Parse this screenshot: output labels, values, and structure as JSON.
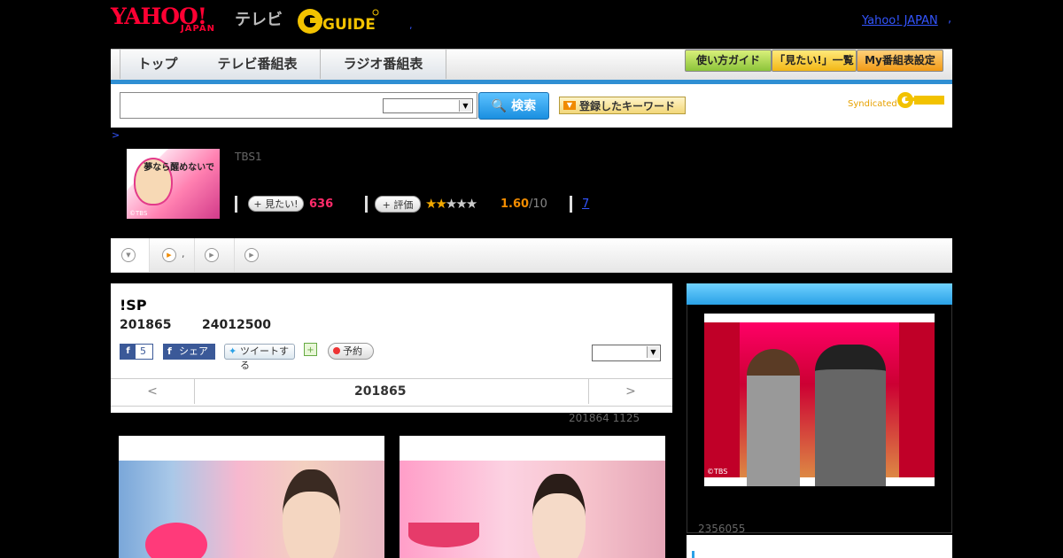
{
  "header": {
    "yahoo_logo": "YAHOO!",
    "japan_logo": "JAPAN",
    "tv_logo": "テレビ",
    "gguide_logo": "G GUIDE",
    "top_link": "Yahoo! JAPAN",
    "top_comma": ",",
    "tiny_dot": ","
  },
  "nav": {
    "tabs": [
      {
        "label": "トップ"
      },
      {
        "label": "テレビ番組表"
      },
      {
        "label": "ラジオ番組表"
      }
    ],
    "buttons": [
      {
        "label": "使い方ガイド"
      },
      {
        "label": "「見たい!」一覧"
      },
      {
        "label": "My番組表設定"
      }
    ]
  },
  "search": {
    "placeholder": "",
    "button_label": "検索",
    "keyword_button": "登録したキーワード",
    "syndicated": "Syndicated"
  },
  "breadcrumb": ">",
  "program": {
    "channel": "TBS1",
    "thumb_title": "夢なら醒めないで",
    "thumb_copyright": "©TBS",
    "want_label": "見たい!",
    "want_count": "636",
    "rate_label": "評価",
    "rating": "1.60",
    "rating_max": "/10",
    "review_count": "7"
  },
  "subnav": {
    "items": [
      {
        "label": ""
      },
      {
        "label": ","
      },
      {
        "label": ""
      },
      {
        "label": ""
      }
    ]
  },
  "main": {
    "title": "!SP",
    "date": "201865",
    "time": "24012500",
    "fb_count": "5",
    "fb_share": "シェア",
    "tweet": "ツイートする",
    "reserve": "予約",
    "prev": "<",
    "next": ">",
    "center_date": "201865",
    "updated": "201864  1125"
  },
  "sidebar": {
    "copyright": "©TBS",
    "number": "2356055"
  },
  "colors": {
    "accent_blue": "#2f8fd3",
    "want_pink": "#ff2b6a",
    "rating_orange": "#f28c00",
    "yahoo_red": "#ff0033"
  }
}
